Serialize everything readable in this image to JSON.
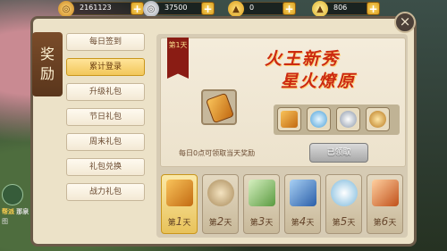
{
  "resources": [
    {
      "icon": "coin-icon",
      "value": "2161123"
    },
    {
      "icon": "silver-coin-icon",
      "value": "37500"
    },
    {
      "icon": "gold-ingot-icon",
      "value": "0"
    },
    {
      "icon": "silver-ingot-icon",
      "value": "806"
    }
  ],
  "panel": {
    "title_line1": "奖",
    "title_line2": "励",
    "close": "×"
  },
  "menu": [
    {
      "label": "每日签到",
      "active": false
    },
    {
      "label": "累计登录",
      "active": true
    },
    {
      "label": "升级礼包",
      "active": false
    },
    {
      "label": "节日礼包",
      "active": false
    },
    {
      "label": "周末礼包",
      "active": false
    },
    {
      "label": "礼包兑换",
      "active": false
    },
    {
      "label": "战力礼包",
      "active": false
    }
  ],
  "banner": {
    "ribbon": "第1天",
    "calligraphy_line1": "火王新秀",
    "calligraphy_line2": "星火燎原",
    "note": "每日0点可领取当天奖励",
    "claimed_button": "已领取"
  },
  "days": [
    {
      "label_pre": "第",
      "num": "1",
      "label_post": "天",
      "selected": true,
      "color": "#e3a030"
    },
    {
      "label_pre": "第",
      "num": "2",
      "label_post": "天",
      "selected": false,
      "color": "#c7a872"
    },
    {
      "label_pre": "第",
      "num": "3",
      "label_post": "天",
      "selected": false,
      "color": "#7fb86a"
    },
    {
      "label_pre": "第",
      "num": "4",
      "label_post": "天",
      "selected": false,
      "color": "#5a8ec8"
    },
    {
      "label_pre": "第",
      "num": "5",
      "label_post": "天",
      "selected": false,
      "color": "#8ec6e6"
    },
    {
      "label_pre": "第",
      "num": "6",
      "label_post": "天",
      "selected": false,
      "color": "#e38a4a"
    }
  ],
  "chat": {
    "line1_tag": "帮派",
    "line1": "那泉",
    "line2": "图"
  }
}
